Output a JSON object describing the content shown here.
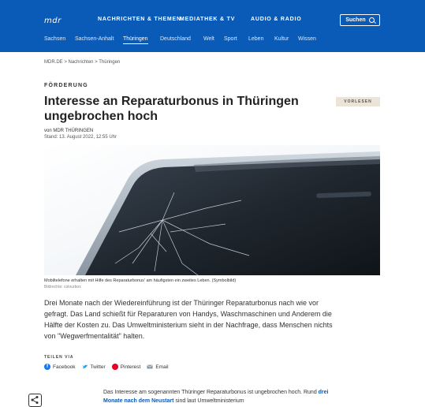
{
  "header": {
    "logo": "mdr",
    "nav": [
      "NACHRICHTEN & THEMEN",
      "MEDIATHEK & TV",
      "AUDIO & RADIO"
    ],
    "search_label": "Suchen",
    "subnav": [
      "Sachsen",
      "Sachsen-Anhalt",
      "Thüringen",
      "Deutschland",
      "Welt",
      "Sport",
      "Leben",
      "Kultur",
      "Wissen"
    ],
    "subnav_active": "Thüringen"
  },
  "breadcrumb": "MDR.DE > Nachrichten > Thüringen",
  "article": {
    "kicker": "FÖRDERUNG",
    "headline": "Interesse an Reparaturbonus in Thüringen ungebrochen hoch",
    "vorlesen": "VORLESEN",
    "byline": "von MDR THÜRINGEN",
    "date": "Stand: 13. August 2022, 12:55 Uhr",
    "image_caption": "Mobiltelefone erhalten mit Hilfe des Reparaturbonus' am häufigsten ein zweites Leben. (Symbolbild)",
    "image_credit": "Bildrechte: colourbox",
    "lead": "Drei Monate nach der Wiedereinführung ist der Thüringer Reparaturbonus nach wie vor gefragt. Das Land schießt für Reparaturen von Handys, Waschmaschinen und Anderem die Hälfte der Kosten zu. Das Umweltministerium sieht in der Nachfrage, dass Menschen nichts von \"Wegwerfmentalität\" halten.",
    "share_label": "TEILEN VIA",
    "share": [
      "Facebook",
      "Twitter",
      "Pinterest",
      "Email"
    ],
    "body_part1": "Das Interesse am sogenannten Thüringer Reparaturbonus ist ungebrochen hoch. Rund ",
    "body_link": "drei Monate nach dem Neustart",
    "body_part2": " sind laut Umweltministerium"
  },
  "colors": {
    "brand": "#0a5bb8",
    "vorlesen_bg": "#ece4d6"
  }
}
